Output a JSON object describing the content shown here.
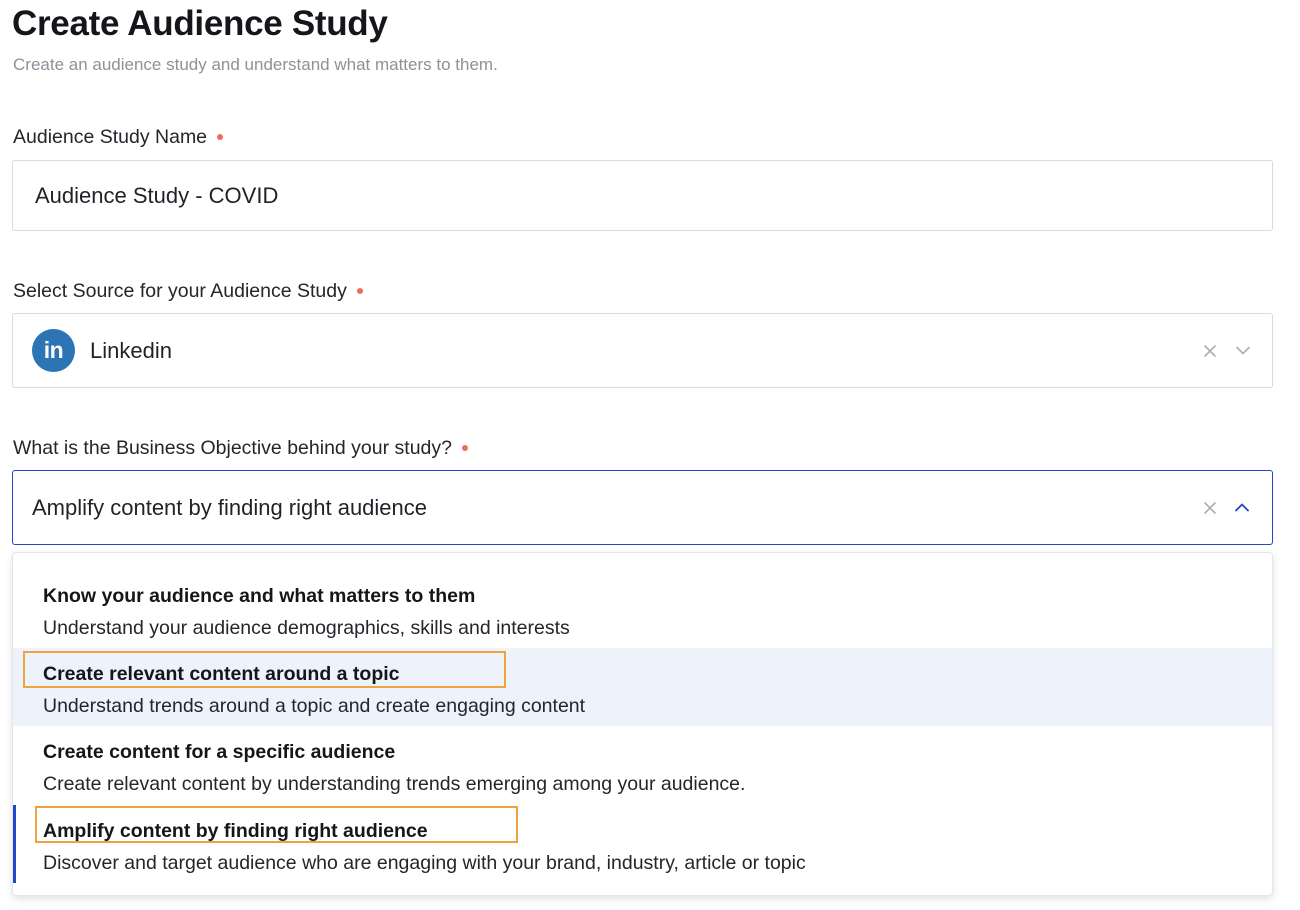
{
  "page": {
    "title": "Create Audience Study",
    "subtitle": "Create an audience study and understand what matters to them."
  },
  "name_field": {
    "label": "Audience Study Name",
    "value": "Audience Study - COVID"
  },
  "source_field": {
    "label": "Select Source for your Audience Study",
    "value": "Linkedin",
    "logo_text": "in",
    "logo_color": "#2d74b4"
  },
  "objective_field": {
    "label": "What is the Business Objective behind your study?",
    "value": "Amplify content by finding right audience",
    "expanded": true
  },
  "objective_options": [
    {
      "title": "Know your audience and what matters to them",
      "description": "Understand your audience demographics, skills and interests"
    },
    {
      "title": "Create relevant content around a topic",
      "description": "Understand trends around a topic and create engaging content"
    },
    {
      "title": "Create content for a specific audience",
      "description": "Create relevant content by understanding trends emerging among your audience."
    },
    {
      "title": "Amplify content by finding right audience",
      "description": "Discover and target audience who are engaging with your brand, industry, article or topic"
    }
  ],
  "colors": {
    "required_dot": "#f06a5d",
    "focus_border": "#1f47c8",
    "hover_bg": "#eef2fb",
    "annotation_highlight": "#f0a23c"
  },
  "icons": {
    "clear": "close-icon",
    "expand": "chevron-down-icon",
    "collapse": "chevron-up-icon"
  }
}
